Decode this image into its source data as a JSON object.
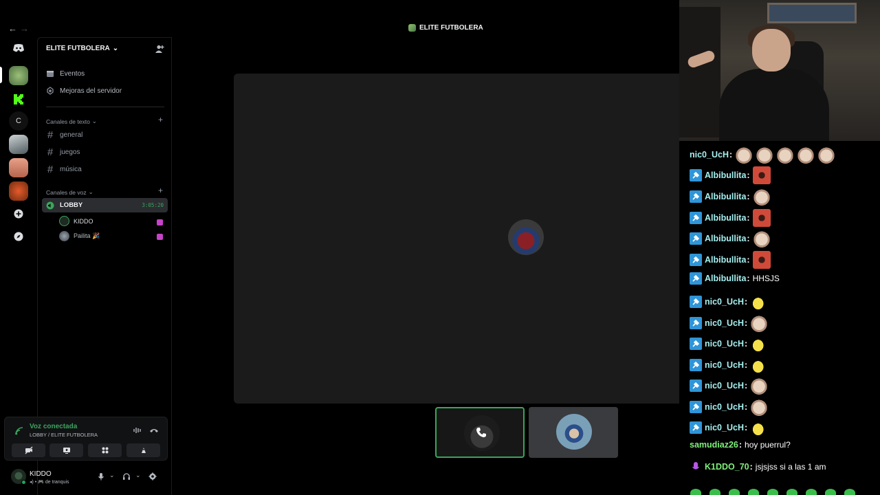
{
  "window": {
    "title": "ELITE FUTBOLERA"
  },
  "server": {
    "name": "ELITE FUTBOLERA",
    "menu": [
      {
        "label": "Eventos",
        "icon": "calendar-icon"
      },
      {
        "label": "Mejoras del servidor",
        "icon": "boost-icon"
      }
    ],
    "text_category": "Canales de texto",
    "text_channels": [
      "general",
      "juegos",
      "música"
    ],
    "voice_category": "Canales de voz",
    "voice_channel": {
      "name": "LOBBY",
      "timer": "3:05:20"
    },
    "voice_users": [
      {
        "name": "KIDDO"
      },
      {
        "name": "Pailita 🎉"
      }
    ]
  },
  "rail": {
    "letter_server": "C"
  },
  "voice_panel": {
    "status": "Voz conectada",
    "location": "LOBBY / ELITE FUTBOLERA"
  },
  "user": {
    "name": "KIDDO",
    "status": "de tranquis"
  },
  "chat": {
    "messages": [
      {
        "user": "nic0_UcH",
        "badge": "none",
        "emotes": [
          "cat",
          "cat",
          "cat",
          "cat",
          "cat"
        ],
        "text": ""
      },
      {
        "user": "Albibullita",
        "badge": "mod",
        "emotes": [
          "red"
        ],
        "text": ""
      },
      {
        "user": "Albibullita",
        "badge": "mod",
        "emotes": [
          "cat"
        ],
        "text": ""
      },
      {
        "user": "Albibullita",
        "badge": "mod",
        "emotes": [
          "red"
        ],
        "text": ""
      },
      {
        "user": "Albibullita",
        "badge": "mod",
        "emotes": [
          "cat"
        ],
        "text": ""
      },
      {
        "user": "Albibullita",
        "badge": "mod",
        "emotes": [
          "red"
        ],
        "text": ""
      },
      {
        "user": "Albibullita",
        "badge": "mod",
        "emotes": [],
        "text": "HHSJS"
      },
      {
        "user": "nic0_UcH",
        "badge": "mod",
        "emotes": [
          "duck"
        ],
        "text": ""
      },
      {
        "user": "nic0_UcH",
        "badge": "mod",
        "emotes": [
          "cat"
        ],
        "text": ""
      },
      {
        "user": "nic0_UcH",
        "badge": "mod",
        "emotes": [
          "duck"
        ],
        "text": ""
      },
      {
        "user": "nic0_UcH",
        "badge": "mod",
        "emotes": [
          "duck"
        ],
        "text": ""
      },
      {
        "user": "nic0_UcH",
        "badge": "mod",
        "emotes": [
          "cat"
        ],
        "text": ""
      },
      {
        "user": "nic0_UcH",
        "badge": "mod",
        "emotes": [
          "cat"
        ],
        "text": ""
      },
      {
        "user": "nic0_UcH",
        "badge": "mod",
        "emotes": [
          "duck"
        ],
        "text": ""
      },
      {
        "user": "samudiaz26",
        "badge": "none",
        "emotes": [],
        "text": "hoy puerrul?"
      },
      {
        "user": "K1DDO_70",
        "badge": "vip",
        "emotes": [],
        "text": "jsjsjss si a las 1 am"
      }
    ]
  },
  "colors": {
    "accent_green": "#3ba55d",
    "mod_badge": "#2f95d8",
    "username_cyan": "#a7f0f0",
    "username_green": "#7ef07a"
  }
}
